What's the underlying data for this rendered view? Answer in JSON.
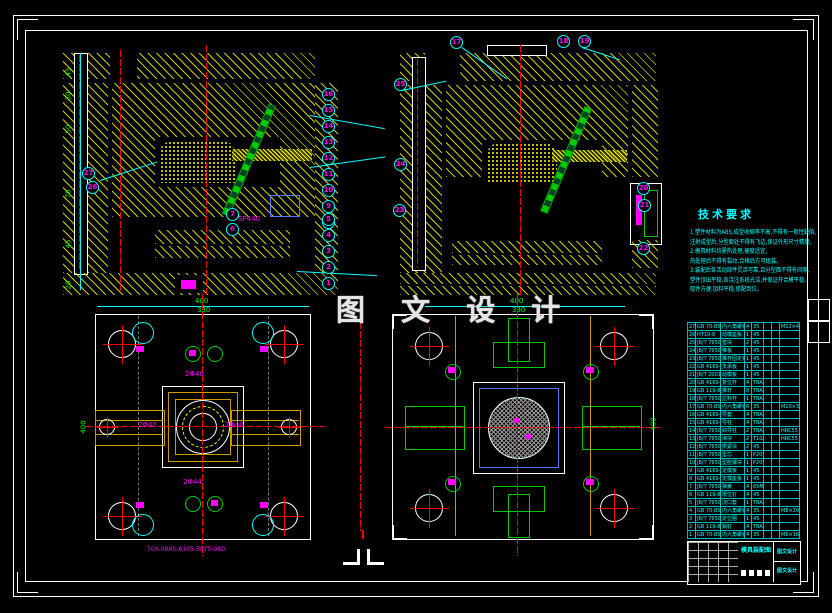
{
  "watermark": "图 文 设 计",
  "tech": {
    "title": "技术要求",
    "lines": [
      "1.塑件材料为ABS,成型收缩率不高,不得有一般性缺陷,",
      "  注射成型后,分型面处不得有飞边,保证外形尺寸精度。",
      "2.模具材料均需热处理,硬度适宜,",
      "  热处理后不得有裂纹,合格后方可组装。",
      "3.装配后各活动部件灵活可靠,且分型面不得有间隙,",
      "  塑件顶出平稳,各浇注系统光洁,并保证开合模平稳,",
      "  取件方便,加料平稳,修配到位。"
    ]
  },
  "dims": {
    "a_left": [
      "45",
      "30",
      "50",
      "70",
      "45",
      "20"
    ],
    "c_top": [
      "400",
      "330"
    ],
    "c_side": "400",
    "d_top": [
      "400",
      "330"
    ],
    "d_side": "400"
  },
  "labels": {
    "sp440": "SP440",
    "code": "70X-08A5-A105-3075-08D",
    "phi": [
      "2Φ40",
      "2Φ40",
      "2Φ40",
      "2Φ44"
    ]
  },
  "callouts": {
    "a_right": [
      "16",
      "15",
      "14",
      "13",
      "12",
      "11",
      "10",
      "9",
      "8"
    ],
    "a_right2": [
      "5",
      "4",
      "3",
      "2",
      "1"
    ],
    "a_left": [
      "27",
      "26"
    ],
    "a_inner": [
      "7",
      "6"
    ],
    "b_top": [
      "17",
      "18",
      "19"
    ],
    "b_left": [
      "25",
      "24",
      "23"
    ],
    "b_right": [
      "20",
      "21",
      "22"
    ]
  },
  "parts": {
    "rows": [
      [
        "27",
        "GB 70-85",
        "内六角螺钉",
        "4",
        "35",
        "",
        "",
        "M12×40"
      ],
      [
        "26",
        "HT10-8",
        "动模座板",
        "1",
        "45",
        "",
        "",
        ""
      ],
      [
        "25",
        "JB/T 7650",
        "垫块",
        "2",
        "45",
        "",
        "",
        ""
      ],
      [
        "24",
        "JB/T 7650",
        "推板",
        "1",
        "45",
        "",
        "",
        ""
      ],
      [
        "23",
        "JB/T 7650",
        "推杆固定板",
        "1",
        "45",
        "",
        "",
        ""
      ],
      [
        "22",
        "GB 4169-84",
        "支承板",
        "1",
        "45",
        "",
        "",
        ""
      ],
      [
        "21",
        "JB/T 2001",
        "动模板",
        "1",
        "45",
        "",
        "",
        ""
      ],
      [
        "20",
        "GB 4169-84",
        "复位杆",
        "4",
        "T8A",
        "",
        "",
        ""
      ],
      [
        "19",
        "GB 119-86",
        "推杆",
        "8",
        "T8A",
        "",
        "",
        ""
      ],
      [
        "18",
        "JB/T 7650",
        "拉料杆",
        "1",
        "T8A",
        "",
        "",
        ""
      ],
      [
        "17",
        "GB 70-85",
        "内六角螺钉",
        "6",
        "35",
        "",
        "",
        "M10×30"
      ],
      [
        "16",
        "GB 4169-84",
        "导套",
        "4",
        "T8A",
        "",
        "",
        ""
      ],
      [
        "15",
        "GB 4169-84",
        "导柱",
        "4",
        "T8A",
        "",
        "",
        ""
      ],
      [
        "14",
        "JB/T 7650",
        "斜导柱",
        "2",
        "T8A",
        "",
        "",
        "HRC55"
      ],
      [
        "13",
        "JB/T 7650",
        "滑块",
        "2",
        "T10A",
        "",
        "",
        "HRC55"
      ],
      [
        "12",
        "JB/T 7650",
        "楔紧块",
        "2",
        "45",
        "",
        "",
        ""
      ],
      [
        "11",
        "JB/T 7650",
        "型芯",
        "1",
        "P20",
        "",
        "",
        ""
      ],
      [
        "10",
        "JB/T 7650",
        "型腔镶块",
        "1",
        "P20",
        "",
        "",
        ""
      ],
      [
        "9",
        "GB 4169-84",
        "定模板",
        "1",
        "45",
        "",
        "",
        ""
      ],
      [
        "8",
        "GB 4169-84",
        "定模座板",
        "1",
        "45",
        "",
        "",
        ""
      ],
      [
        "7",
        "JB/T 7650",
        "弹簧",
        "4",
        "65Mn",
        "",
        "",
        ""
      ],
      [
        "6",
        "GB 119-86",
        "限位钉",
        "4",
        "45",
        "",
        "",
        ""
      ],
      [
        "5",
        "JB/T 7650",
        "浇口套",
        "1",
        "T8A",
        "",
        "",
        ""
      ],
      [
        "4",
        "GB 70-85",
        "内六角螺钉",
        "4",
        "35",
        "",
        "",
        "M8×20"
      ],
      [
        "3",
        "JB/T 7650",
        "定位圈",
        "1",
        "45",
        "",
        "",
        ""
      ],
      [
        "2",
        "GB 119-86",
        "销钉",
        "4",
        "T8A",
        "",
        "",
        ""
      ],
      [
        "1",
        "GB 70-85",
        "内六角螺钉",
        "4",
        "35",
        "",
        "",
        "M6×16"
      ]
    ]
  },
  "title_block": {
    "center": "模具装配图",
    "right_top": "图文设计",
    "right_bottom": "图文设计"
  },
  "colors": {
    "hatch_yellow": "#e1e100",
    "accent_cyan": "#00ffff",
    "callout_magenta": "#ff00ff",
    "dim_green": "#00ff00",
    "centerline_red": "#ff0000"
  }
}
